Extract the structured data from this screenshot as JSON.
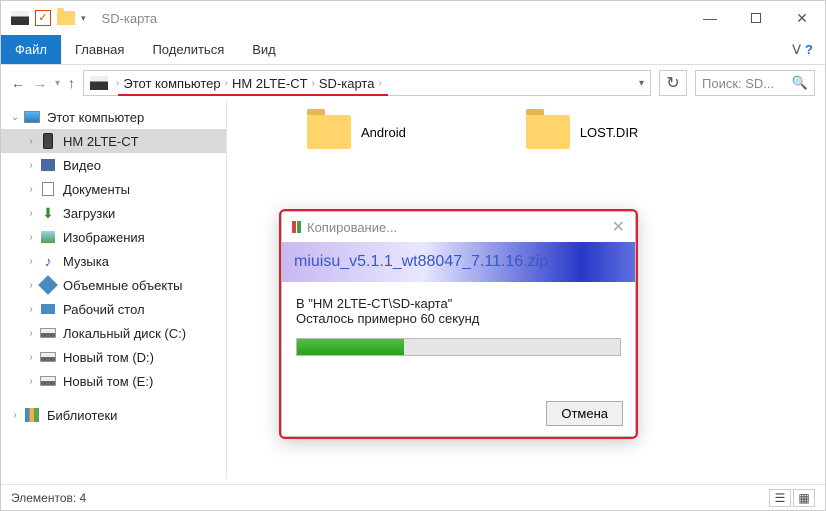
{
  "window": {
    "title": "SD-карта"
  },
  "ribbon": {
    "file": "Файл",
    "tabs": [
      "Главная",
      "Поделиться",
      "Вид"
    ],
    "expand": "ᐯ",
    "help": "?"
  },
  "address": {
    "segments": [
      "Этот компьютер",
      "HM 2LTE-CT",
      "SD-карта"
    ]
  },
  "search": {
    "placeholder": "Поиск: SD..."
  },
  "tree": {
    "root": "Этот компьютер",
    "items": [
      {
        "label": "HM 2LTE-CT",
        "icon": "phone",
        "selected": true
      },
      {
        "label": "Видео",
        "icon": "video"
      },
      {
        "label": "Документы",
        "icon": "doc"
      },
      {
        "label": "Загрузки",
        "icon": "dl"
      },
      {
        "label": "Изображения",
        "icon": "img"
      },
      {
        "label": "Музыка",
        "icon": "music"
      },
      {
        "label": "Объемные объекты",
        "icon": "3d"
      },
      {
        "label": "Рабочий стол",
        "icon": "desk"
      },
      {
        "label": "Локальный диск (C:)",
        "icon": "drive"
      },
      {
        "label": "Новый том (D:)",
        "icon": "drive"
      },
      {
        "label": "Новый том (E:)",
        "icon": "drive"
      }
    ],
    "libraries": "Библиотеки"
  },
  "content": {
    "folders": [
      "Android",
      "LOST.DIR"
    ]
  },
  "dialog": {
    "title": "Копирование...",
    "filename": "miuisu_v5.1.1_wt88047_7.11.16.zip",
    "destination": "В \"HM 2LTE-CT\\SD-карта\"",
    "remaining": "Осталось примерно 60 секунд",
    "progress_percent": 33,
    "cancel": "Отмена"
  },
  "status": {
    "count_label": "Элементов: 4"
  }
}
